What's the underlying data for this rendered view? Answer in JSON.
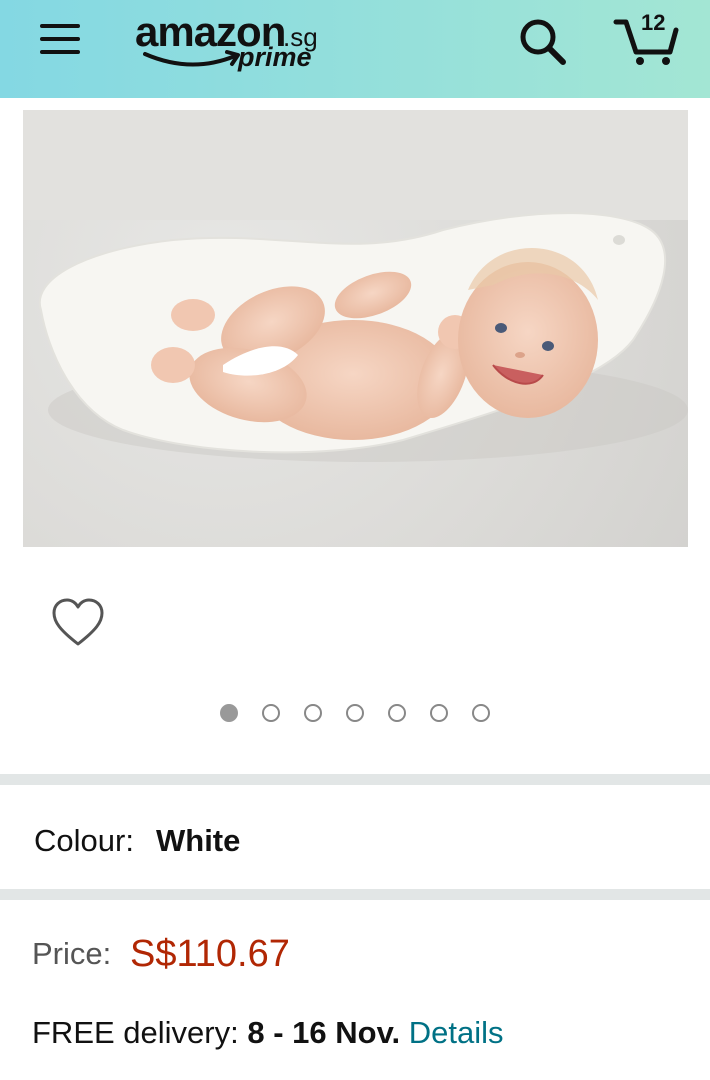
{
  "header": {
    "logo_word": "amazon",
    "logo_tld": ".sg",
    "logo_prime": "prime",
    "cart_count": "12",
    "background_colors": [
      "#84d8e3",
      "#a3e6d4"
    ]
  },
  "gallery": {
    "image_count": 7,
    "active_index": 0
  },
  "product": {
    "colour_label": "Colour:",
    "colour_value": "White",
    "price_label": "Price:",
    "price_value": "S$110.67",
    "delivery_label": "FREE delivery:",
    "delivery_dates": "8 - 16 Nov.",
    "details_link": "Details"
  },
  "colors": {
    "price": "#b12704",
    "link": "#007185",
    "divider": "#e2e6e6"
  },
  "icons": {
    "menu": "hamburger-icon",
    "search": "search-icon",
    "cart": "cart-icon",
    "wishlist": "heart-icon"
  }
}
